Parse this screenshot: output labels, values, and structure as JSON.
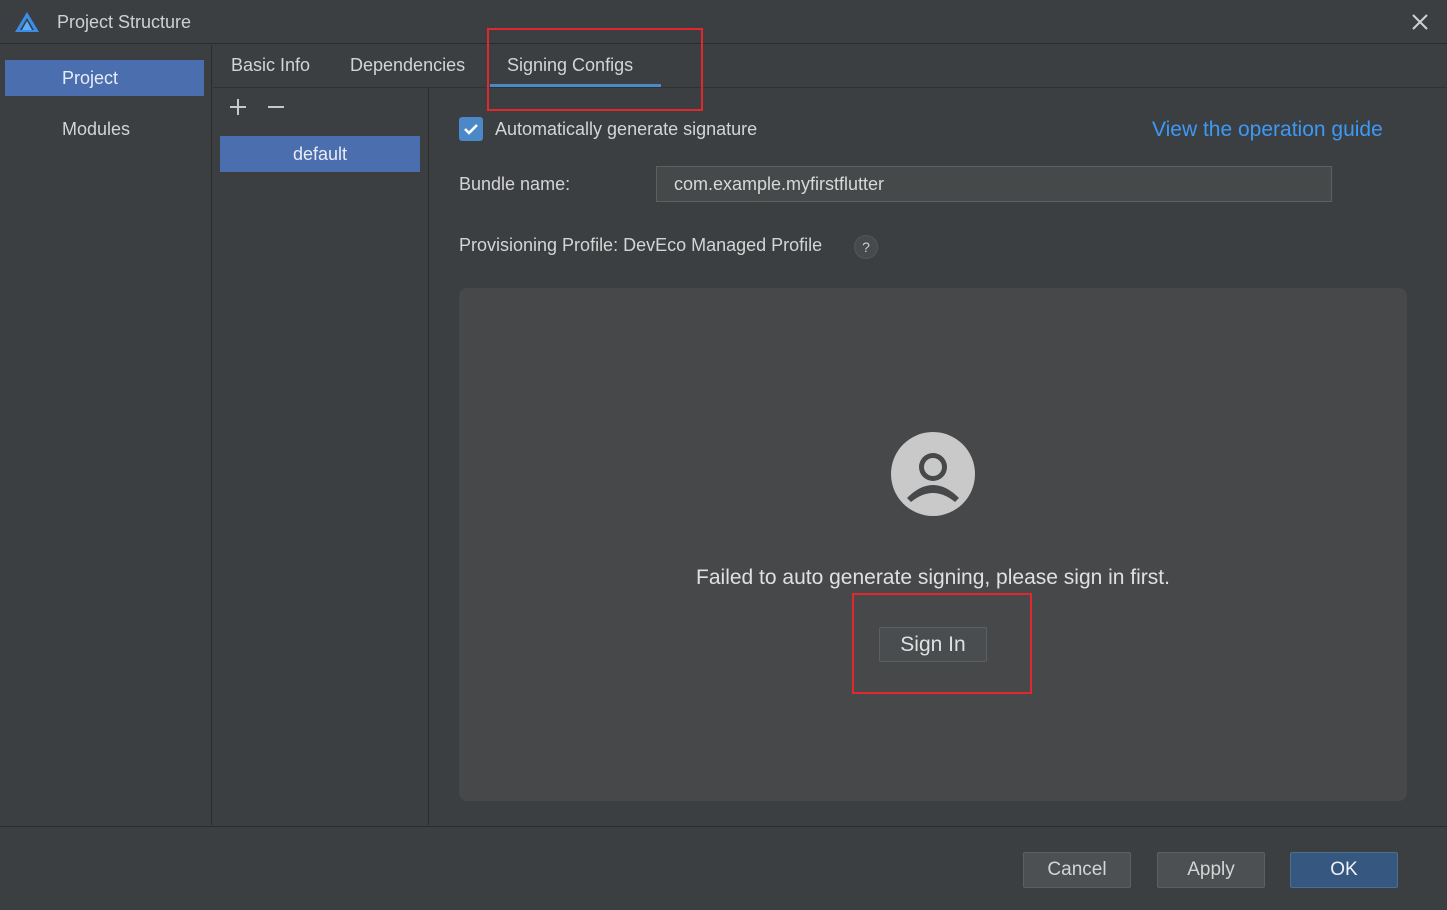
{
  "window": {
    "title": "Project Structure"
  },
  "sidebar": {
    "items": [
      {
        "label": "Project",
        "active": true
      },
      {
        "label": "Modules",
        "active": false
      }
    ]
  },
  "tabs": [
    {
      "label": "Basic Info"
    },
    {
      "label": "Dependencies"
    },
    {
      "label": "Signing Configs",
      "active": true
    }
  ],
  "configs": {
    "items": [
      {
        "label": "default"
      }
    ]
  },
  "signing": {
    "auto_generate_label": "Automatically generate signature",
    "auto_generate_checked": true,
    "guide_link": "View the operation guide",
    "bundle_label": "Bundle name:",
    "bundle_value": "com.example.myfirstflutter",
    "profile_label": "Provisioning Profile: DevEco Managed Profile",
    "help_glyph": "?",
    "message": "Failed to auto generate signing, please sign in first.",
    "sign_in_label": "Sign In"
  },
  "footer": {
    "cancel_label": "Cancel",
    "apply_label": "Apply",
    "ok_label": "OK"
  },
  "colors": {
    "accent": "#4b6eaf",
    "link": "#3d99f5",
    "primary_button": "#365880",
    "annotation": "#e0282e"
  }
}
